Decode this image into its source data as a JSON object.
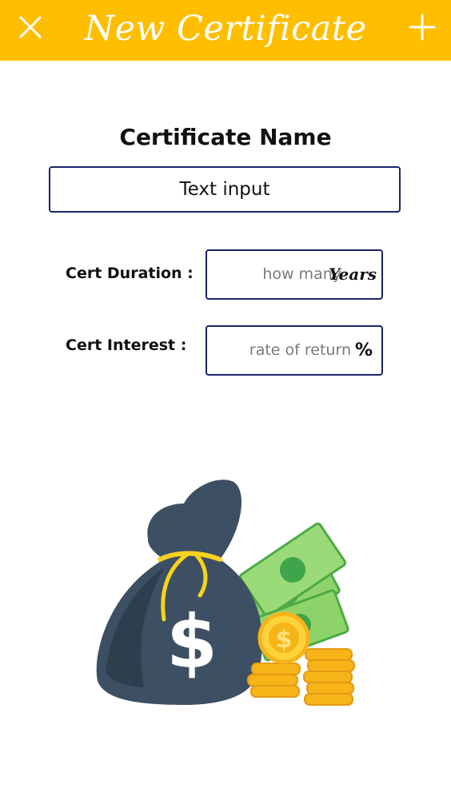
{
  "header": {
    "title": "New Certificate",
    "close_icon": "close-icon",
    "add_icon": "plus-icon",
    "color": "#FFBE00"
  },
  "form": {
    "section_title": "Certificate Name",
    "name_input": {
      "value": "Text input"
    },
    "duration": {
      "label": "Cert Duration :",
      "placeholder": "how many",
      "unit": "Years"
    },
    "interest": {
      "label": "Cert Interest :",
      "placeholder": "rate of return",
      "unit": "%"
    }
  },
  "illustration": {
    "name": "money-bag-with-cash-and-coins",
    "colors": {
      "bag": "#3D4F62",
      "tie": "#F7D21E",
      "cash": "#5CC25A",
      "coin": "#F6B419"
    }
  }
}
